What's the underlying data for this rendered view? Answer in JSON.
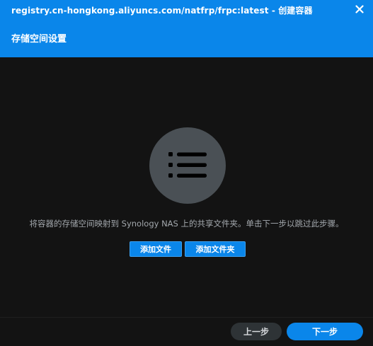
{
  "window": {
    "title": "registry.cn-hongkong.aliyuncs.com/natfrp/frpc:latest - 创建容器",
    "close_icon": "close-icon"
  },
  "header": {
    "title": "存储空间设置"
  },
  "main": {
    "illustration_icon": "list-icon",
    "description": "将容器的存储空间映射到 Synology NAS 上的共享文件夹。单击下一步以跳过此步骤。",
    "add_file_label": "添加文件",
    "add_folder_label": "添加文件夹"
  },
  "footer": {
    "prev_label": "上一步",
    "next_label": "下一步"
  },
  "colors": {
    "accent": "#0a86ea",
    "background": "#131313",
    "illustration_bg": "#4a5055"
  }
}
